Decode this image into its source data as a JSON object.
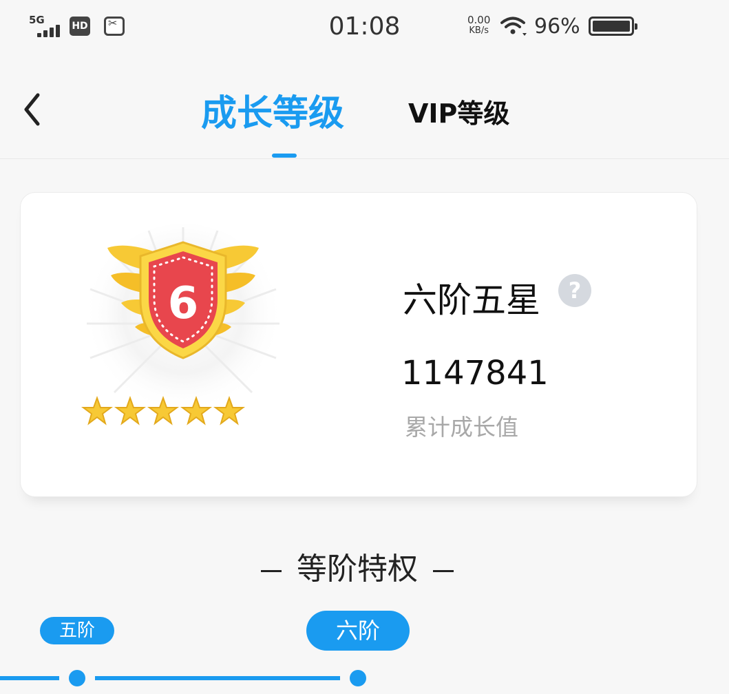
{
  "status_bar": {
    "network": "5G",
    "hd": "HD",
    "time": "01:08",
    "speed_value": "0.00",
    "speed_unit": "KB/s",
    "battery": "96%"
  },
  "nav": {
    "tabs": [
      {
        "label": "成长等级",
        "active": true
      },
      {
        "label": "VIP等级",
        "active": false
      }
    ]
  },
  "level_card": {
    "badge_number": "6",
    "stars": 5,
    "level_name": "六阶五星",
    "help_symbol": "?",
    "points": "1147841",
    "points_label": "累计成长值"
  },
  "privileges": {
    "title": "等阶特权",
    "tiers": [
      {
        "label": "五阶",
        "current": false
      },
      {
        "label": "六阶",
        "current": true
      }
    ]
  },
  "colors": {
    "accent": "#1a9bf0",
    "badge_red": "#e8464d",
    "badge_gold": "#f7c935"
  }
}
